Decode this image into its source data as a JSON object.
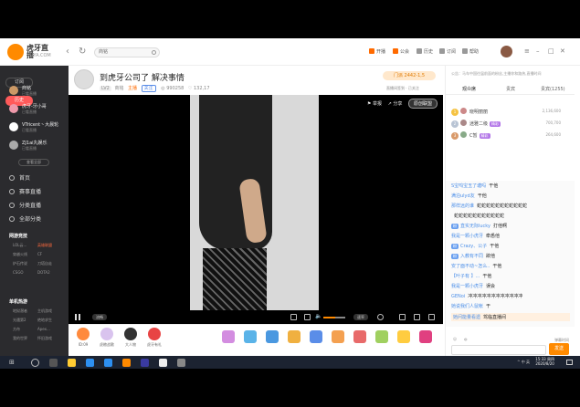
{
  "header": {
    "logo_text": "虎牙直播",
    "logo_sub": "HUYA.COM",
    "search_value": "商铭",
    "links": [
      {
        "label": "开播",
        "color": "#ff6a00"
      },
      {
        "label": "公会",
        "color": "#ff6a00"
      },
      {
        "label": "历史",
        "color": "#666666"
      },
      {
        "label": "订阅",
        "color": "#666666"
      },
      {
        "label": "帮助",
        "color": "#666666"
      }
    ]
  },
  "sidebar": {
    "tabs": [
      "订阅",
      "历史"
    ],
    "channels": [
      {
        "name": "商铭",
        "status": "已看直播"
      },
      {
        "name": "虎牙-牙小哥",
        "status": "已看直播"
      },
      {
        "name": "VTricent丶大晨轮",
        "status": "已看直播"
      },
      {
        "name": "ZJ1ai丸娱乐",
        "status": "已看直播"
      }
    ],
    "more": "查看全部",
    "nav": [
      "首页",
      "赛事直播",
      "分类直播",
      "全部分类"
    ],
    "section1": "网游竞技",
    "games1": [
      {
        "name": "LOL云...",
        "hot": false
      },
      {
        "name": "英雄联盟",
        "hot": true
      },
      {
        "name": "穿越火线",
        "hot": false
      },
      {
        "name": "CF",
        "hot": false
      },
      {
        "name": "炉石传说",
        "hot": false
      },
      {
        "name": "刀塔自走",
        "hot": false
      },
      {
        "name": "CSGO",
        "hot": false
      },
      {
        "name": "DOTA2",
        "hot": false
      }
    ],
    "section2": "单机热游",
    "games2": [
      {
        "name": "地狱潜者",
        "hot": false
      },
      {
        "name": "主机游戏",
        "hot": false
      },
      {
        "name": "光遇第2",
        "hot": false
      },
      {
        "name": "绝地求生",
        "hot": false
      },
      {
        "name": "方舟",
        "hot": false
      },
      {
        "name": "Apex...",
        "hot": false
      },
      {
        "name": "我的世界",
        "hot": false
      },
      {
        "name": "怀旧游戏",
        "hot": false
      }
    ]
  },
  "room": {
    "title": "到虎牙公司了 解决事情",
    "host": "商铭",
    "level": "LV2",
    "category": "主播",
    "fav": "关注",
    "views": "990258",
    "followers": "132,17",
    "tag": "门派 2442-1,5",
    "actions": "直播间签到 · 已关注"
  },
  "player": {
    "top_report": "举报",
    "top_share": "分享",
    "top_fans": "原创联盟",
    "quality": "流畅",
    "speed": "速率",
    "volume": 0.55
  },
  "giftbar": {
    "items": [
      {
        "label": "ID:09",
        "color": "#ff8a3d"
      },
      {
        "label": "虎粮战歌",
        "color": "#d9c3ee"
      },
      {
        "label": "大人物",
        "color": "#333333"
      },
      {
        "label": "虎牙有礼",
        "color": "#e84444"
      }
    ],
    "gift_colors": [
      "#d38de0",
      "#5ab3e8",
      "#4a98e0",
      "#f0b040",
      "#5a8de8",
      "#f4a050",
      "#e86a6a",
      "#a0d060",
      "#ffcc40",
      "#e04080"
    ]
  },
  "chat": {
    "notice": "公告：马车中国往届前面的粉丝,主播你和路热,直播时间",
    "tabs": [
      "观众席",
      "贵宾",
      "贵宾(1255)"
    ],
    "rank": [
      {
        "num": "1",
        "name": "晓明丽丽",
        "badge": "",
        "score": "2,136,600"
      },
      {
        "num": "2",
        "name": "迷雅二级",
        "badge": "精彩",
        "score": "700,700"
      },
      {
        "num": "3",
        "name": "C暂",
        "badge": "精彩",
        "score": "264,600"
      }
    ],
    "messages": [
      {
        "user": "S宝呜宝玉了塘吗",
        "badge": "",
        "text": "干他"
      },
      {
        "user": "满泊ulyd友",
        "badge": "",
        "text": "干他"
      },
      {
        "user": "那样远的谁",
        "badge": "",
        "text": "蛇蛇蛇蛇蛇蛇蛇蛇蛇蛇蛇"
      },
      {
        "user": "",
        "badge": "",
        "text": "蛇蛇蛇蛇蛇蛇蛇蛇蛇蛇蛇"
      },
      {
        "user": "直实无际lucky",
        "badge": "粉",
        "text": "打他啊"
      },
      {
        "user": "我是一颗小虎牙",
        "badge": "",
        "text": "牵悉他"
      },
      {
        "user": "Crazy、公子",
        "badge": "粉",
        "text": "干他"
      },
      {
        "user": "入教有不同",
        "badge": "粉",
        "text": "欲他"
      },
      {
        "user": "安了面不动~怎么..",
        "badge": "",
        "text": "干他"
      },
      {
        "user": "【叶子有 】...",
        "badge": "",
        "text": "干他"
      },
      {
        "user": "我是一颗小虎牙",
        "badge": "",
        "text": "误会"
      },
      {
        "user": "GENoi",
        "badge": "",
        "text": "冲冲冲冲冲冲冲冲冲冲冲冲"
      },
      {
        "user": "她说我们人鼠帐",
        "badge": "",
        "text": "干"
      },
      {
        "user": "她问能量看遗",
        "badge": "",
        "text": "驾临直播间",
        "sys": true
      }
    ],
    "input_placeholder": "",
    "tools_right": "弹幕时间",
    "send": "发送"
  },
  "taskbar": {
    "time": "15:33 周四",
    "date": "2020/8/20",
    "tray": "^ 中 英"
  }
}
